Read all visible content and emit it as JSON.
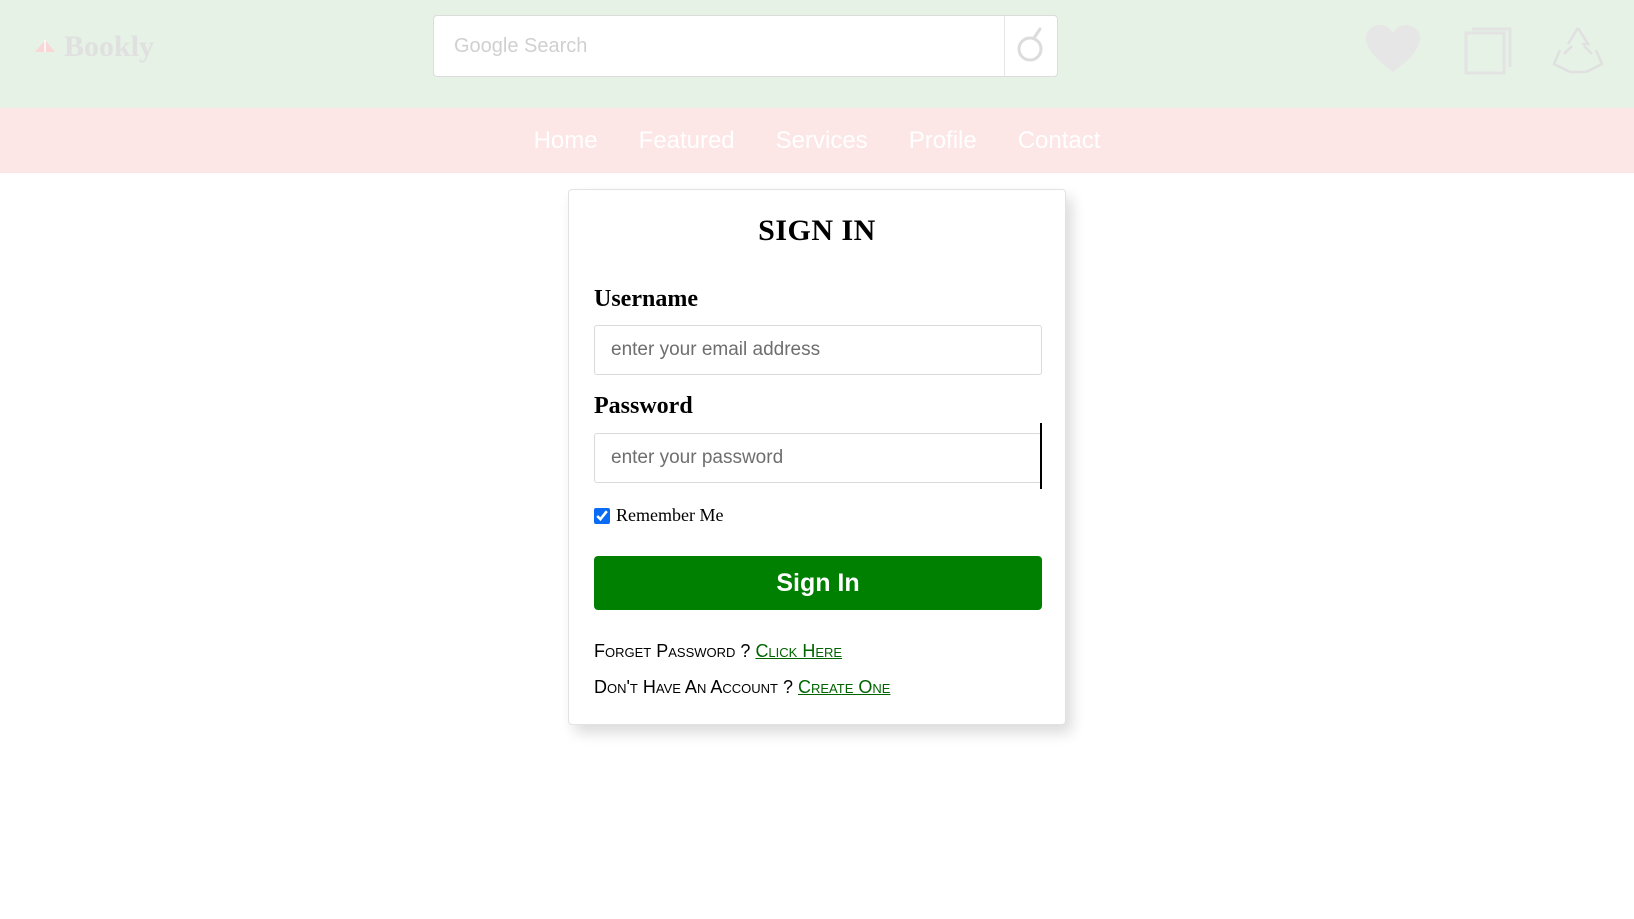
{
  "header": {
    "brand": "Bookly",
    "search_placeholder": "Google Search",
    "icons": [
      "heart-icon",
      "book-icon",
      "recycle-icon"
    ]
  },
  "nav": {
    "items": [
      "Home",
      "Featured",
      "Services",
      "Profile",
      "Contact"
    ]
  },
  "form": {
    "title": "SIGN IN",
    "username_label": "Username",
    "username_placeholder": "enter your email address",
    "password_label": "Password",
    "password_placeholder": "enter your password",
    "remember_label": "Remember Me",
    "remember_checked": true,
    "submit_label": "Sign In",
    "forget_text": "Forget Password ?",
    "forget_link": "Click Here",
    "account_text": "Don't Have An Account ?",
    "account_link": "Create One"
  },
  "colors": {
    "topbar_bg": "#e6f2e6",
    "navbar_bg": "#fde6e6",
    "button_bg": "#008000",
    "link": "#006400"
  }
}
